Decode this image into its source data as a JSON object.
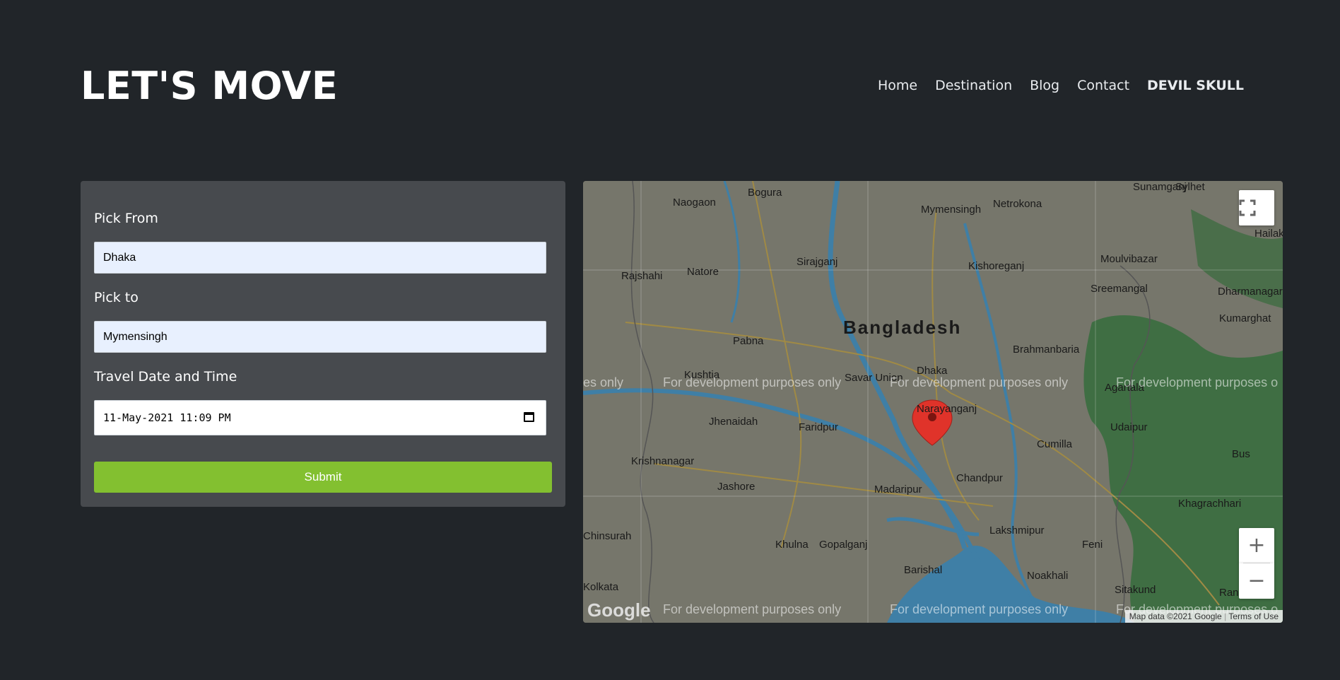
{
  "header": {
    "brand": "LET'S MOVE",
    "nav": [
      "Home",
      "Destination",
      "Blog",
      "Contact"
    ],
    "user": "DEVIL SKULL"
  },
  "form": {
    "pick_from_label": "Pick From",
    "pick_from_value": "Dhaka",
    "pick_to_label": "Pick to",
    "pick_to_value": "Mymensingh",
    "datetime_label": "Travel Date and Time",
    "datetime_value": "11-May-2021 11:09 PM",
    "submit_label": "Submit"
  },
  "map": {
    "country_label": "Bangladesh",
    "dev_watermark": "For development purposes only",
    "dev_watermark_edge_left": "es only",
    "dev_watermark_edge_right": "For development purposes o",
    "places": [
      "Bogura",
      "Naogaon",
      "Mymensingh",
      "Netrokona",
      "Sunamganj",
      "Sylhet",
      "Rajshahi",
      "Natore",
      "Sirajganj",
      "Kishoreganj",
      "Moulvibazar",
      "Sreemangal",
      "Dharmanagar",
      "Pabna",
      "Kumarghat",
      "Kushtia",
      "Savar Union",
      "Dhaka",
      "Brahmanbaria",
      "Agartala",
      "Narayanganj",
      "Jhenaidah",
      "Faridpur",
      "Udaipur",
      "Krishnanagar",
      "Jashore",
      "Madaripur",
      "Chandpur",
      "Cumilla",
      "Chinsurah",
      "Khulna",
      "Gopalganj",
      "Lakshmipur",
      "Feni",
      "Khagrachhari",
      "Barishal",
      "Noakhali",
      "Kolkata",
      "Sitakund",
      "Rangamati",
      "Bus",
      "Hailak"
    ],
    "attribution": "Map data ©2021 Google",
    "terms": "Terms of Use",
    "google_logo": "Google",
    "controls": {
      "fullscreen_icon": "fullscreen-icon",
      "zoom_in_icon": "plus-icon",
      "zoom_out_icon": "minus-icon"
    },
    "colors": {
      "land": "#6f6e63",
      "water": "#3f7fa6",
      "forest": "#3f6e43",
      "road": "#a08a45",
      "marker": "#e0332a"
    }
  },
  "colors": {
    "background": "#212529",
    "card": "#474a4e",
    "submit": "#83c030",
    "input_autofill": "#e8f0fe"
  }
}
